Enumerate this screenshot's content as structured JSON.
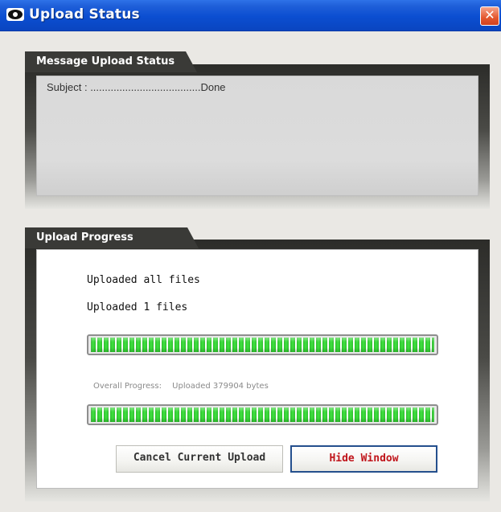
{
  "window": {
    "title": "Upload Status",
    "close_glyph": "✕"
  },
  "message_panel": {
    "title": "Message Upload Status",
    "line": "Subject : ......................................Done"
  },
  "progress_panel": {
    "title": "Upload Progress",
    "status_line1": "Uploaded all files",
    "status_line2": "Uploaded 1 files",
    "current_progress": 1.0,
    "overall_label": "Overall Progress:",
    "overall_value": "Uploaded 379904 bytes",
    "overall_progress": 1.0
  },
  "buttons": {
    "cancel_label": "Cancel Current Upload",
    "hide_label": "Hide Window"
  },
  "colors": {
    "titlebar": "#0b4ed1",
    "progress_green": "#3fe23f",
    "hide_text": "#c0151b",
    "hide_border": "#244f8d"
  },
  "icons": {
    "app_icon": "eye-icon",
    "close": "close-icon"
  }
}
